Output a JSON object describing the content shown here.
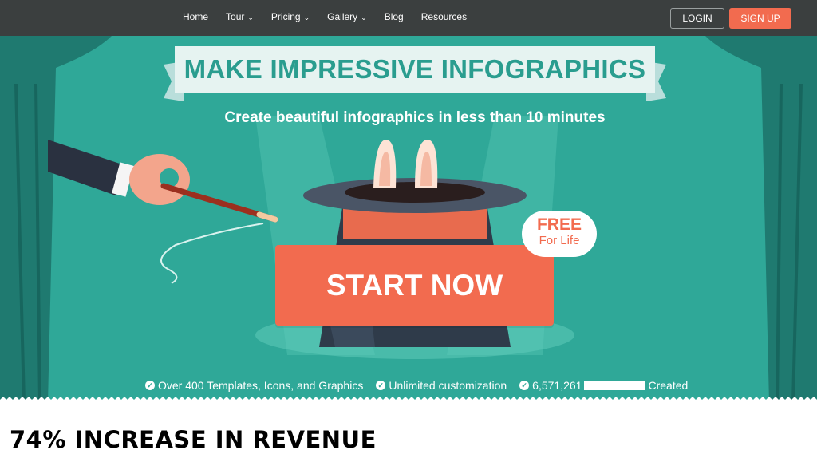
{
  "nav": {
    "links": [
      {
        "label": "Home",
        "dropdown": false
      },
      {
        "label": "Tour",
        "dropdown": true
      },
      {
        "label": "Pricing",
        "dropdown": true
      },
      {
        "label": "Gallery",
        "dropdown": true
      },
      {
        "label": "Blog",
        "dropdown": false
      },
      {
        "label": "Resources",
        "dropdown": false
      }
    ],
    "chevron": "⌄",
    "login_label": "LOGIN",
    "signup_label": "SIGN UP"
  },
  "hero": {
    "banner_text": "MAKE IMPRESSIVE INFOGRAPHICS",
    "subtitle": "Create beautiful infographics in less than 10 minutes",
    "start_label": "START NOW",
    "free_line1": "FREE",
    "free_line2": "For Life",
    "features": {
      "f1": "Over 400 Templates, Icons, and Graphics",
      "f2": "Unlimited customization",
      "f3_prefix": "6,571,261",
      "f3_suffix": "Created"
    }
  },
  "page_heading": "74% INCREASE IN REVENUE",
  "colors": {
    "nav_bg": "#3b3f3f",
    "hero_bg": "#2fa898",
    "accent": "#f26b4f",
    "banner_text": "#2a9d8f"
  }
}
